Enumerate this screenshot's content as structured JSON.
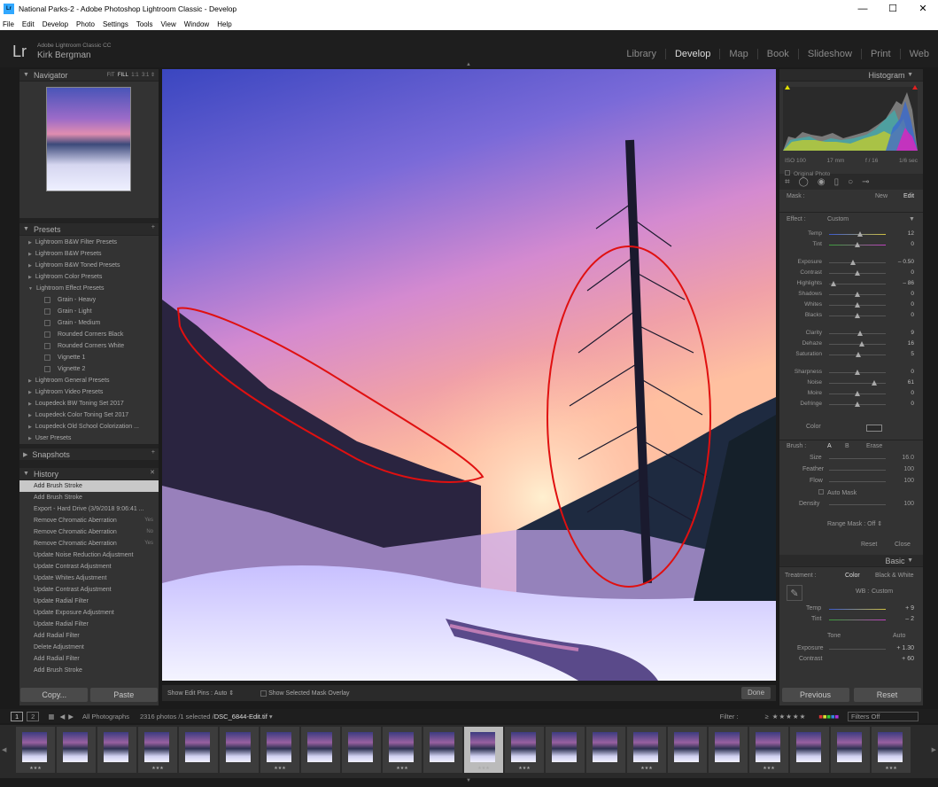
{
  "window": {
    "title": "National Parks-2 - Adobe Photoshop Lightroom Classic - Develop",
    "min": "—",
    "max": "☐",
    "close": "✕"
  },
  "menu": [
    "File",
    "Edit",
    "Develop",
    "Photo",
    "Settings",
    "Tools",
    "View",
    "Window",
    "Help"
  ],
  "identity": {
    "product": "Adobe Lightroom Classic CC",
    "user": "Kirk Bergman",
    "logo": "Lr"
  },
  "modules": [
    "Library",
    "Develop",
    "Map",
    "Book",
    "Slideshow",
    "Print",
    "Web"
  ],
  "navigator": {
    "title": "Navigator",
    "zoom": [
      "FIT",
      "FILL",
      "1:1",
      "3:1"
    ]
  },
  "presets": {
    "title": "Presets",
    "items": [
      "Lightroom B&W Filter Presets",
      "Lightroom B&W Presets",
      "Lightroom B&W Toned Presets",
      "Lightroom Color Presets",
      "Lightroom Effect Presets"
    ],
    "sub": [
      "Grain - Heavy",
      "Grain - Light",
      "Grain - Medium",
      "Rounded Corners Black",
      "Rounded Corners White",
      "Vignette 1",
      "Vignette 2"
    ],
    "items2": [
      "Lightroom General Presets",
      "Lightroom Video Presets",
      "Loupedeck BW Toning Set 2017",
      "Loupedeck Color Toning Set 2017",
      "Loupedeck Old School Colorization ...",
      "User Presets"
    ]
  },
  "snapshots": {
    "title": "Snapshots"
  },
  "history": {
    "title": "History",
    "items": [
      "Add Brush Stroke",
      "Add Brush Stroke",
      "Export - Hard Drive (3/9/2018 9:06:41 ...",
      "Remove Chromatic Aberration",
      "Remove Chromatic Aberration",
      "Remove Chromatic Aberration",
      "Update Noise Reduction Adjustment",
      "Update Contrast Adjustment",
      "Update Whites Adjustment",
      "Update Contrast Adjustment",
      "Update Radial Filter",
      "Update Exposure Adjustment",
      "Update Radial Filter",
      "Add Radial Filter",
      "Delete Adjustment",
      "Add Radial Filter",
      "Add Brush Stroke"
    ],
    "flags": [
      "",
      "",
      "",
      "Yes",
      "No",
      "Yes"
    ]
  },
  "leftbuttons": {
    "copy": "Copy...",
    "paste": "Paste"
  },
  "toolbar": {
    "pins_label": "Show Edit Pins :",
    "pins_value": "Auto",
    "overlay": "Show Selected Mask Overlay",
    "done": "Done"
  },
  "histogram": {
    "title": "Histogram",
    "iso": "ISO 100",
    "focal": "17 mm",
    "aperture": "f / 16",
    "shutter": "1/6 sec",
    "original": "Original Photo"
  },
  "mask": {
    "label": "Mask :",
    "new": "New",
    "edit": "Edit"
  },
  "effect": {
    "label": "Effect :",
    "value": "Custom"
  },
  "sliders": [
    {
      "name": "Temp",
      "value": "12",
      "pos": 0.55
    },
    {
      "name": "Tint",
      "value": "0",
      "pos": 0.5
    },
    {
      "name": "Exposure",
      "value": "– 0.50",
      "pos": 0.42
    },
    {
      "name": "Contrast",
      "value": "0",
      "pos": 0.5
    },
    {
      "name": "Highlights",
      "value": "– 86",
      "pos": 0.08
    },
    {
      "name": "Shadows",
      "value": "0",
      "pos": 0.5
    },
    {
      "name": "Whites",
      "value": "0",
      "pos": 0.5
    },
    {
      "name": "Blacks",
      "value": "0",
      "pos": 0.5
    },
    {
      "name": "Clarity",
      "value": "9",
      "pos": 0.55
    },
    {
      "name": "Dehaze",
      "value": "16",
      "pos": 0.58
    },
    {
      "name": "Saturation",
      "value": "5",
      "pos": 0.52
    },
    {
      "name": "Sharpness",
      "value": "0",
      "pos": 0.5
    },
    {
      "name": "Noise",
      "value": "61",
      "pos": 0.8
    },
    {
      "name": "Moire",
      "value": "0",
      "pos": 0.5
    },
    {
      "name": "Defringe",
      "value": "0",
      "pos": 0.5
    }
  ],
  "color_label": "Color",
  "brush": {
    "label": "Brush :",
    "a": "A",
    "b": "B",
    "erase": "Erase",
    "size_l": "Size",
    "size": "16.0",
    "feather_l": "Feather",
    "feather": "100",
    "flow_l": "Flow",
    "flow": "100",
    "automask": "Auto Mask",
    "density_l": "Density",
    "density": "100",
    "range": "Range Mask :",
    "range_v": "Off",
    "reset": "Reset",
    "close": "Close"
  },
  "basic": {
    "title": "Basic",
    "treatment": "Treatment :",
    "color": "Color",
    "bw": "Black & White",
    "wb": "WB :",
    "wb_v": "Custom",
    "temp_l": "Temp",
    "temp": "+ 9",
    "tint_l": "Tint",
    "tint": "– 2",
    "tone": "Tone",
    "auto": "Auto",
    "exp_l": "Exposure",
    "exp": "+ 1.30",
    "con_l": "Contrast",
    "con": "+ 60"
  },
  "rightbuttons": {
    "previous": "Previous",
    "reset": "Reset"
  },
  "filmbar": {
    "v1": "1",
    "v2": "2",
    "source": "All Photographs",
    "count": "2316 photos /1 selected /",
    "file": "DSC_6844-Edit.tif",
    "filter": "Filter :",
    "filters_off": "Filters Off"
  }
}
